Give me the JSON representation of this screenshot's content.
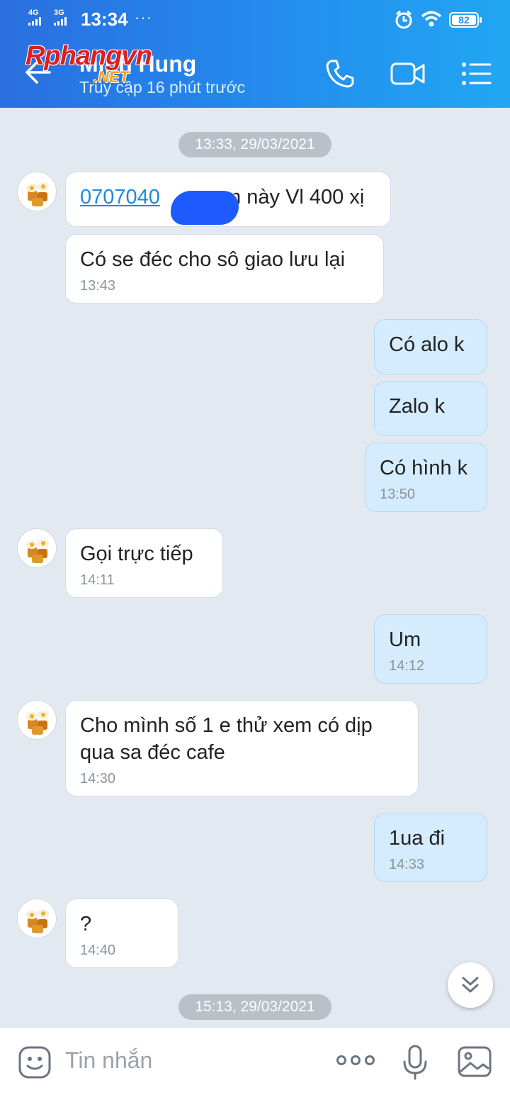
{
  "status_bar": {
    "net1": "4G",
    "net2": "3G",
    "time": "13:34",
    "more": "···",
    "battery": "82"
  },
  "header": {
    "title": "Minh Hung",
    "subtitle": "Truy cập 16 phút trước",
    "watermark_main": "Rphangvn",
    "watermark_suffix": ".NET",
    "icons": [
      "back-arrow-icon",
      "phone-icon",
      "video-call-icon",
      "menu-list-icon"
    ]
  },
  "chat": {
    "date_chips": [
      "13:33, 29/03/2021",
      "15:13, 29/03/2021"
    ],
    "messages": [
      {
        "side": "in",
        "link": "0707040",
        "text": "em này Vl 400 xị",
        "time": ""
      },
      {
        "side": "in",
        "text": "Có se đéc cho sô giao lưu lại",
        "time": "13:43"
      },
      {
        "side": "out",
        "text": "Có alo k",
        "time": ""
      },
      {
        "side": "out",
        "text": "Zalo k",
        "time": ""
      },
      {
        "side": "out",
        "text": "Có hình k",
        "time": "13:50"
      },
      {
        "side": "in",
        "text": "Gọi trực tiếp",
        "time": "14:11"
      },
      {
        "side": "out",
        "text": "Um",
        "time": "14:12"
      },
      {
        "side": "in",
        "text_line1": "Cho mình số 1 e thử xem có dịp",
        "text_line2": "qua sa đéc cafe",
        "time": "14:30"
      },
      {
        "side": "out",
        "text": "1ua đi",
        "time": "14:33"
      },
      {
        "side": "in",
        "text": "?",
        "time": "14:40"
      }
    ]
  },
  "input_bar": {
    "placeholder": "Tin nhắn",
    "icons": [
      "sticker-icon",
      "more-options-icon",
      "microphone-icon",
      "image-icon"
    ]
  },
  "colors": {
    "header_gradient_start": "#2a6fe0",
    "header_gradient_end": "#22a7f3",
    "outgoing_bubble": "#d4ecfd",
    "incoming_bubble": "#ffffff",
    "chat_background": "#e2e9f1",
    "link": "#1d8ad9"
  }
}
